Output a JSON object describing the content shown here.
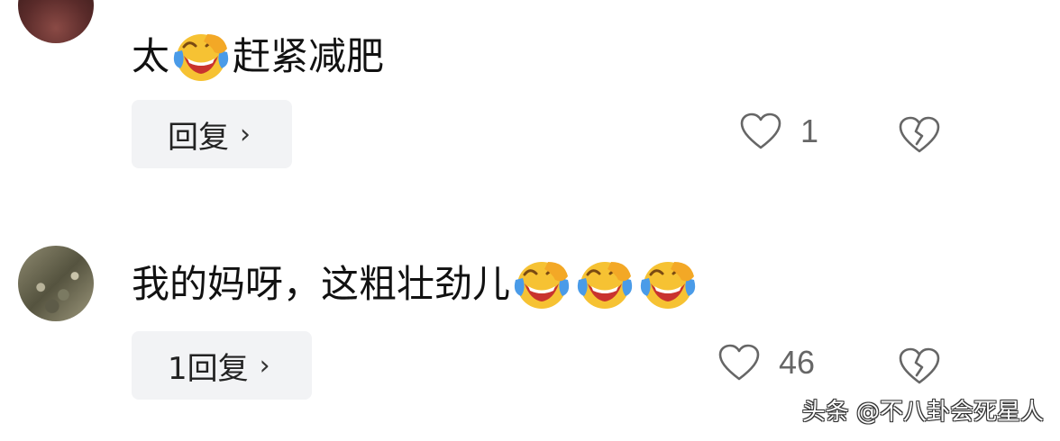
{
  "comments": [
    {
      "text_before": "太",
      "emoji": "face-with-tears-of-joy",
      "text_after": "赶紧减肥",
      "reply_label": "回复",
      "reply_chevron": "›",
      "like_count": "1"
    },
    {
      "text_before": "我的妈呀，这粗壮劲儿",
      "emoji": "face-with-tears-of-joy",
      "emoji_count": 3,
      "reply_label": "1回复",
      "reply_chevron": "›",
      "like_count": "46"
    }
  ],
  "watermark": "头条 @不八卦会死星人",
  "colors": {
    "reply_bg": "#f2f3f5",
    "icon_stroke": "#666666",
    "emoji_face": "#f6c233",
    "emoji_tear": "#4a9be8"
  }
}
